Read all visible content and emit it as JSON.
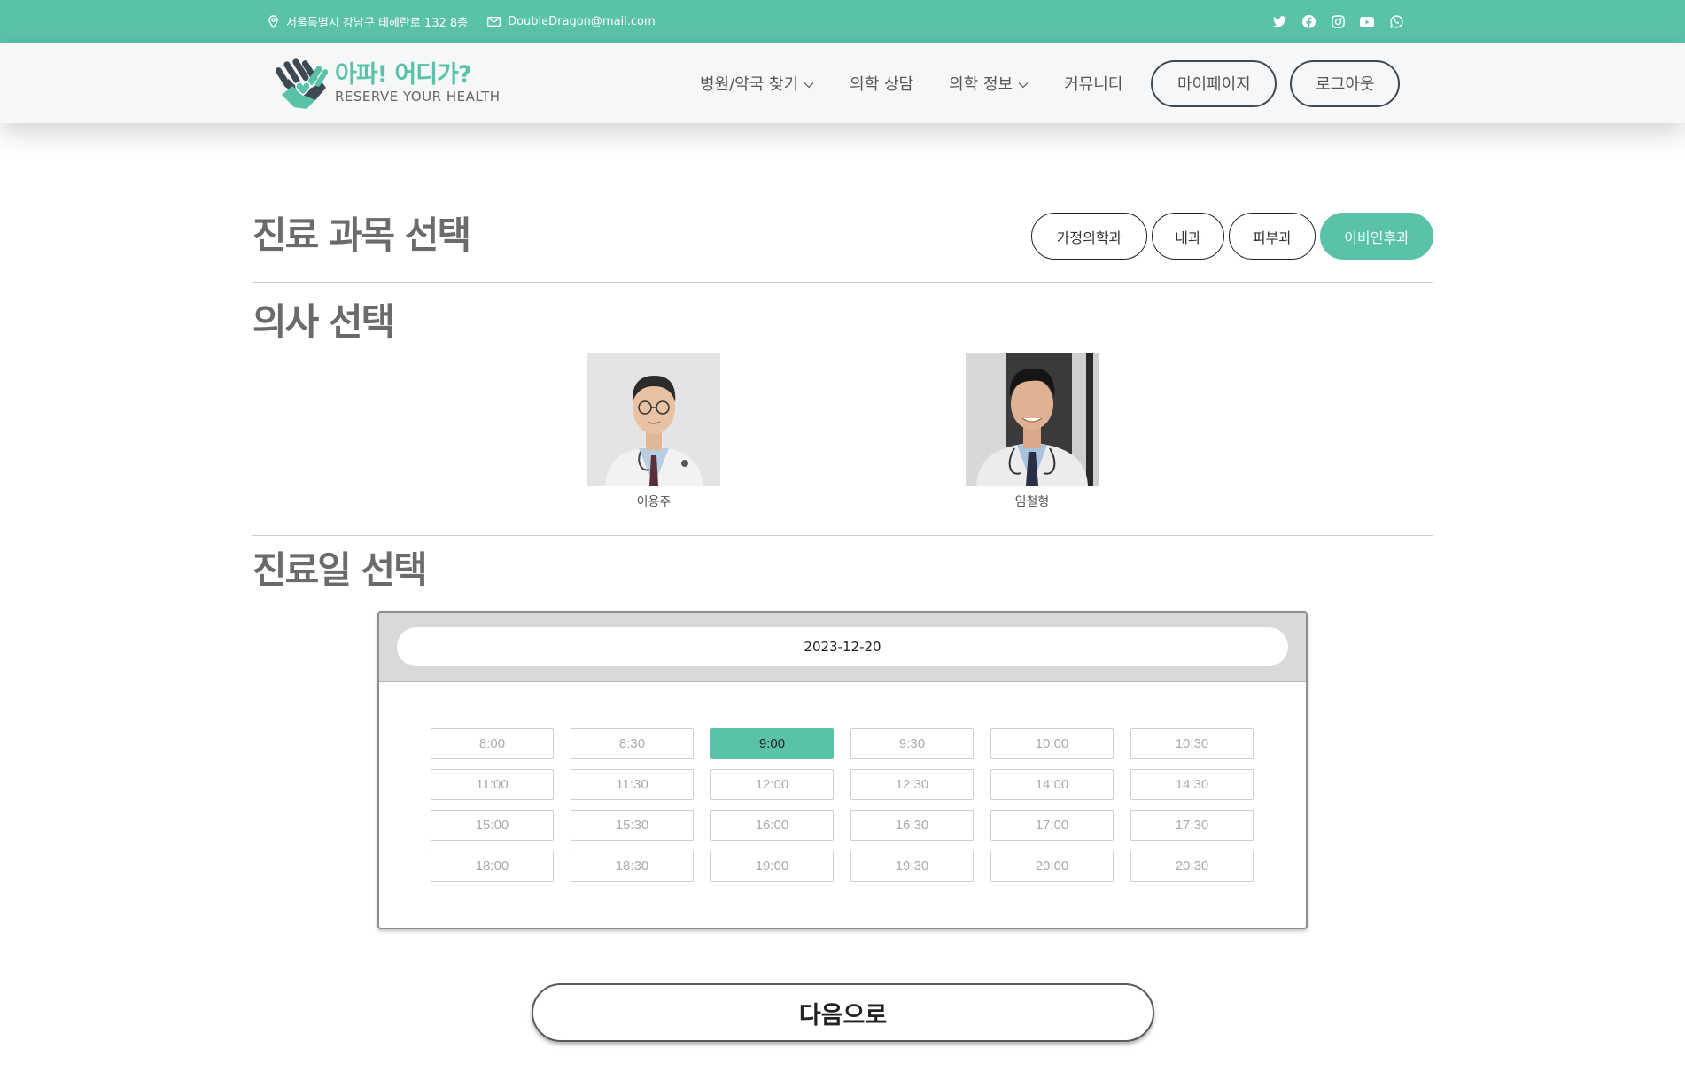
{
  "topbar": {
    "address": "서울특별시 강남구 테헤란로 132 8층",
    "email": "DoubleDragon@mail.com",
    "social_icons": [
      "twitter-icon",
      "facebook-icon",
      "instagram-icon",
      "youtube-icon",
      "whatsapp-icon"
    ]
  },
  "header": {
    "logo_main": "아파! 어디가?",
    "logo_sub": "RESERVE YOUR HEALTH",
    "nav": [
      {
        "label": "병원/약국 찾기",
        "dropdown": true
      },
      {
        "label": "의학 상담",
        "dropdown": false
      },
      {
        "label": "의학 정보",
        "dropdown": true
      },
      {
        "label": "커뮤니티",
        "dropdown": false
      }
    ],
    "mypage_label": "마이페이지",
    "logout_label": "로그아웃"
  },
  "department": {
    "title": "진료 과목 선택",
    "tabs": [
      "가정의학과",
      "내과",
      "피부과",
      "이비인후과"
    ],
    "active": "이비인후과"
  },
  "doctor_section": {
    "title": "의사 선택",
    "doctors": [
      {
        "name": "이용주"
      },
      {
        "name": "임철형"
      }
    ]
  },
  "date_section": {
    "title": "진료일 선택",
    "date_value": "2023-12-20",
    "slots": [
      "8:00",
      "8:30",
      "9:00",
      "9:30",
      "10:00",
      "10:30",
      "11:00",
      "11:30",
      "12:00",
      "12:30",
      "14:00",
      "14:30",
      "15:00",
      "15:30",
      "16:00",
      "16:30",
      "17:00",
      "17:30",
      "18:00",
      "18:30",
      "19:00",
      "19:30",
      "20:00",
      "20:30"
    ],
    "selected_slot": "9:00"
  },
  "next_label": "다음으로",
  "colors": {
    "accent": "#5bc2aa",
    "dark": "#3d4a54"
  }
}
